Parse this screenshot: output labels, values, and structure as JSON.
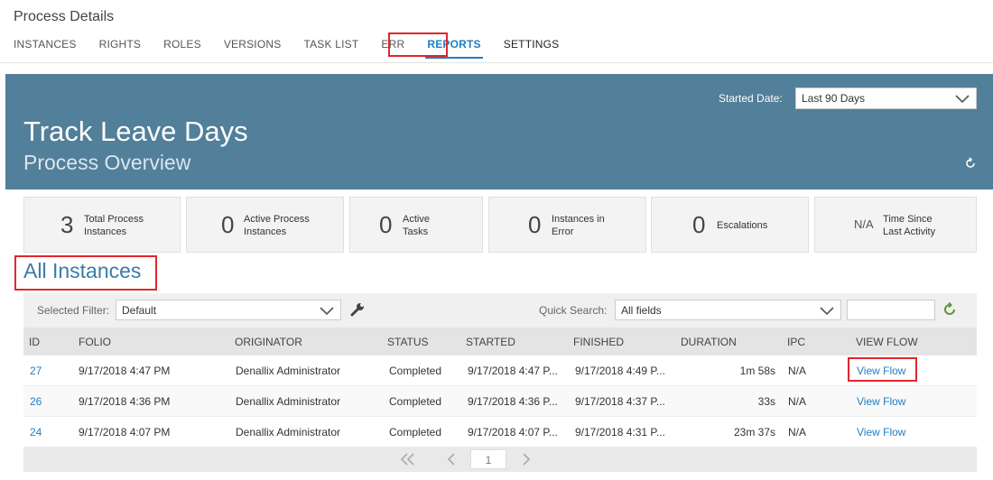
{
  "header": {
    "title": "Process Details",
    "tabs": [
      {
        "label": "INSTANCES"
      },
      {
        "label": "RIGHTS"
      },
      {
        "label": "ROLES"
      },
      {
        "label": "VERSIONS"
      },
      {
        "label": "TASK LIST"
      },
      {
        "label": "ERR"
      },
      {
        "label": "REPORTS"
      },
      {
        "label": "SETTINGS"
      }
    ]
  },
  "banner": {
    "title": "Track Leave Days",
    "subtitle": "Process Overview",
    "started_date_label": "Started Date:",
    "started_date_value": "Last 90 Days"
  },
  "stats": [
    {
      "value": "3",
      "label_1": "Total Process",
      "label_2": "Instances"
    },
    {
      "value": "0",
      "label_1": "Active Process",
      "label_2": "Instances"
    },
    {
      "value": "0",
      "label_1": "Active",
      "label_2": "Tasks"
    },
    {
      "value": "0",
      "label_1": "Instances in",
      "label_2": "Error"
    },
    {
      "value": "0",
      "label_1": "Escalations",
      "label_2": ""
    },
    {
      "value": "N/A",
      "label_1": "Time Since",
      "label_2": "Last Activity"
    }
  ],
  "instances": {
    "heading": "All Instances",
    "filter_label": "Selected Filter:",
    "filter_value": "Default",
    "quick_search_label": "Quick Search:",
    "quick_search_value": "All fields",
    "columns": [
      "ID",
      "FOLIO",
      "ORIGINATOR",
      "STATUS",
      "STARTED",
      "FINISHED",
      "DURATION",
      "IPC",
      "VIEW FLOW"
    ],
    "rows": [
      {
        "id": "27",
        "folio": "9/17/2018 4:47 PM",
        "originator": "Denallix Administrator",
        "status": "Completed",
        "started": "9/17/2018 4:47 P...",
        "finished": "9/17/2018 4:49 P...",
        "duration": "1m 58s",
        "ipc": "N/A",
        "view_flow": "View Flow"
      },
      {
        "id": "26",
        "folio": "9/17/2018 4:36 PM",
        "originator": "Denallix Administrator",
        "status": "Completed",
        "started": "9/17/2018 4:36 P...",
        "finished": "9/17/2018 4:37 P...",
        "duration": "33s",
        "ipc": "N/A",
        "view_flow": "View Flow"
      },
      {
        "id": "24",
        "folio": "9/17/2018 4:07 PM",
        "originator": "Denallix Administrator",
        "status": "Completed",
        "started": "9/17/2018 4:07 P...",
        "finished": "9/17/2018 4:31 P...",
        "duration": "23m 37s",
        "ipc": "N/A",
        "view_flow": "View Flow"
      }
    ],
    "pager": {
      "page": "1"
    }
  },
  "colors": {
    "banner": "#527f99",
    "accent": "#1f7fc4",
    "highlight": "#e0262c"
  }
}
